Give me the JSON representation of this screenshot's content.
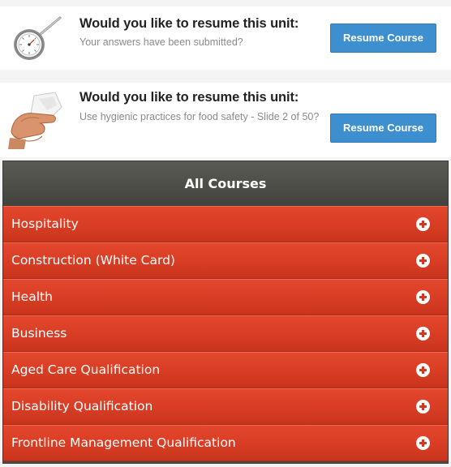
{
  "resume_units": [
    {
      "title": "Would you like to resume this unit:",
      "subtitle": "Your answers have been submitted?",
      "button_label": "Resume Course",
      "image_icon": "thermometer-image"
    },
    {
      "title": "Would you like to resume this unit:",
      "subtitle": "Use hygienic practices for food safety - Slide 2 of 50?",
      "button_label": "Resume Course",
      "image_icon": "hands-washing-image"
    }
  ],
  "courses": {
    "header": "All Courses",
    "items": [
      {
        "label": "Hospitality"
      },
      {
        "label": "Construction (White Card)"
      },
      {
        "label": "Health"
      },
      {
        "label": "Business"
      },
      {
        "label": "Aged Care Qualification"
      },
      {
        "label": "Disability Qualification"
      },
      {
        "label": "Frontline Management Qualification"
      }
    ]
  },
  "colors": {
    "accent_button": "#3d8fd0",
    "course_row": "#d83d24",
    "header_bg": "#4a4a44"
  }
}
